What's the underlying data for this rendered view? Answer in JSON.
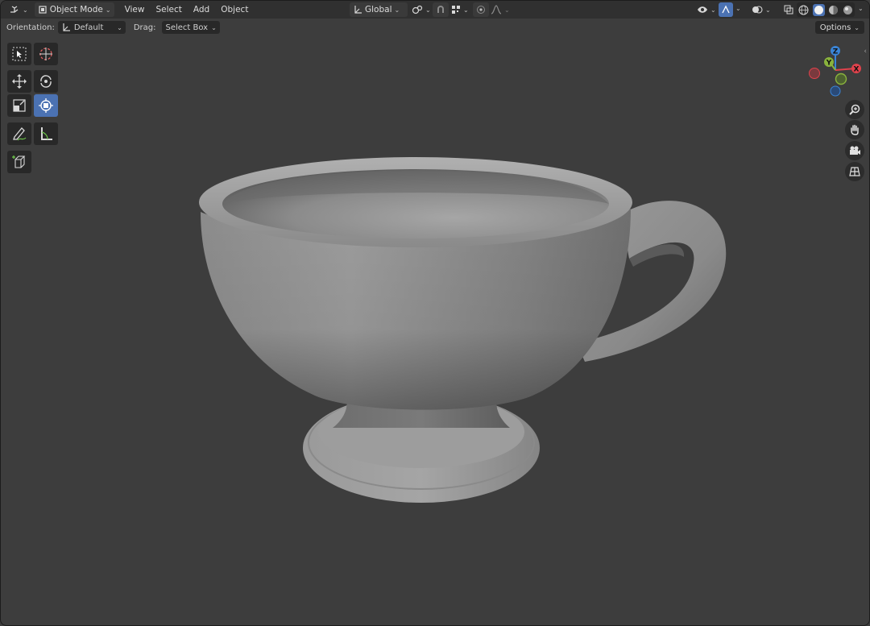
{
  "header": {
    "editor_type_icon": "view3d-editor-icon",
    "mode": {
      "icon": "object-mode-icon",
      "label": "Object Mode"
    },
    "menus": [
      "View",
      "Select",
      "Add",
      "Object"
    ],
    "transform_orientation": {
      "icon": "orientation-axes-icon",
      "label": "Global"
    },
    "pivot_icon": "pivot-icon",
    "snap_icon": "magnet-snap-icon",
    "snap_target_icon": "snap-increment-icon",
    "proportional_icon": "proportional-edit-icon",
    "falloff_icon": "falloff-curve-icon",
    "visibility_icon": "eye-selectability-icon",
    "gizmo_icon": "gizmo-toggle-icon",
    "overlay_icon": "overlay-icon",
    "xray_icon": "xray-icon",
    "shading_modes": [
      "wireframe-shading-icon",
      "solid-shading-icon",
      "material-shading-icon",
      "rendered-shading-icon"
    ],
    "active_shading": "solid-shading-icon"
  },
  "tool_settings": {
    "orientation_label": "Orientation:",
    "orientation_value": "Default",
    "drag_label": "Drag:",
    "drag_value": "Select Box",
    "options_label": "Options"
  },
  "toolbar": {
    "tools": [
      "select-box-icon",
      "cursor-icon",
      "move-icon",
      "rotate-icon",
      "scale-icon",
      "transform-icon",
      "annotate-icon",
      "measure-icon",
      "add-cube-icon"
    ],
    "active_tool": "transform-icon"
  },
  "navigation": {
    "axes": {
      "x": "X",
      "y": "Y",
      "z": "Z"
    },
    "axis_colors": {
      "x": "#e0424c",
      "y": "#8ab33d",
      "z": "#3a84d6"
    },
    "buttons": [
      "zoom-icon",
      "pan-hand-icon",
      "camera-icon",
      "ortho-grid-icon"
    ]
  },
  "viewport": {
    "background": "#3d3d3d",
    "object": "teacup-mesh"
  }
}
